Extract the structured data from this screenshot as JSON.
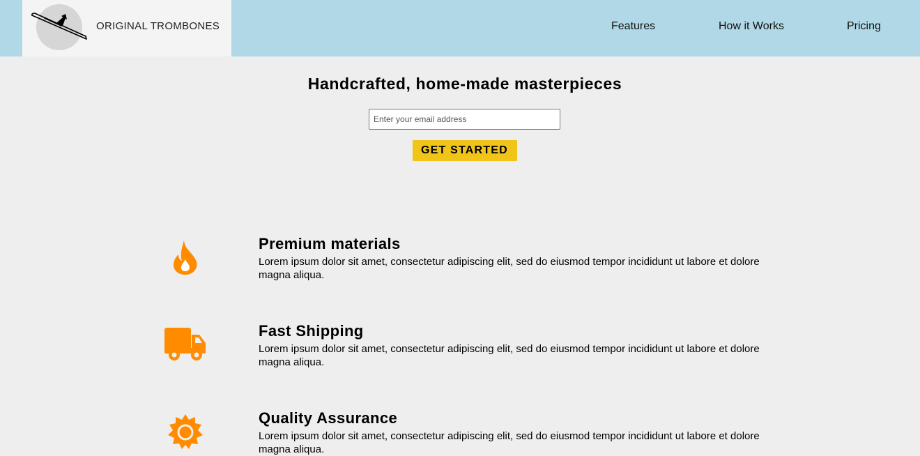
{
  "header": {
    "brand": "ORIGINAL TROMBONES",
    "nav": [
      {
        "label": "Features"
      },
      {
        "label": "How it Works"
      },
      {
        "label": "Pricing"
      }
    ]
  },
  "hero": {
    "headline": "Handcrafted, home-made masterpieces",
    "email_placeholder": "Enter your email address",
    "cta_label": "GET STARTED"
  },
  "features": [
    {
      "icon": "fire-icon",
      "title": "Premium materials",
      "description": "Lorem ipsum dolor sit amet, consectetur adipiscing elit, sed do eiusmod tempor incididunt ut labore et dolore magna aliqua."
    },
    {
      "icon": "truck-icon",
      "title": "Fast Shipping",
      "description": "Lorem ipsum dolor sit amet, consectetur adipiscing elit, sed do eiusmod tempor incididunt ut labore et dolore magna aliqua."
    },
    {
      "icon": "badge-check-icon",
      "title": "Quality Assurance",
      "description": "Lorem ipsum dolor sit amet, consectetur adipiscing elit, sed do eiusmod tempor incididunt ut labore et dolore magna aliqua."
    }
  ],
  "colors": {
    "header_bg": "#b0d8e6",
    "accent_icon": "#ff8c00",
    "cta_bg": "#f0c419",
    "page_bg": "#eeeeee"
  }
}
